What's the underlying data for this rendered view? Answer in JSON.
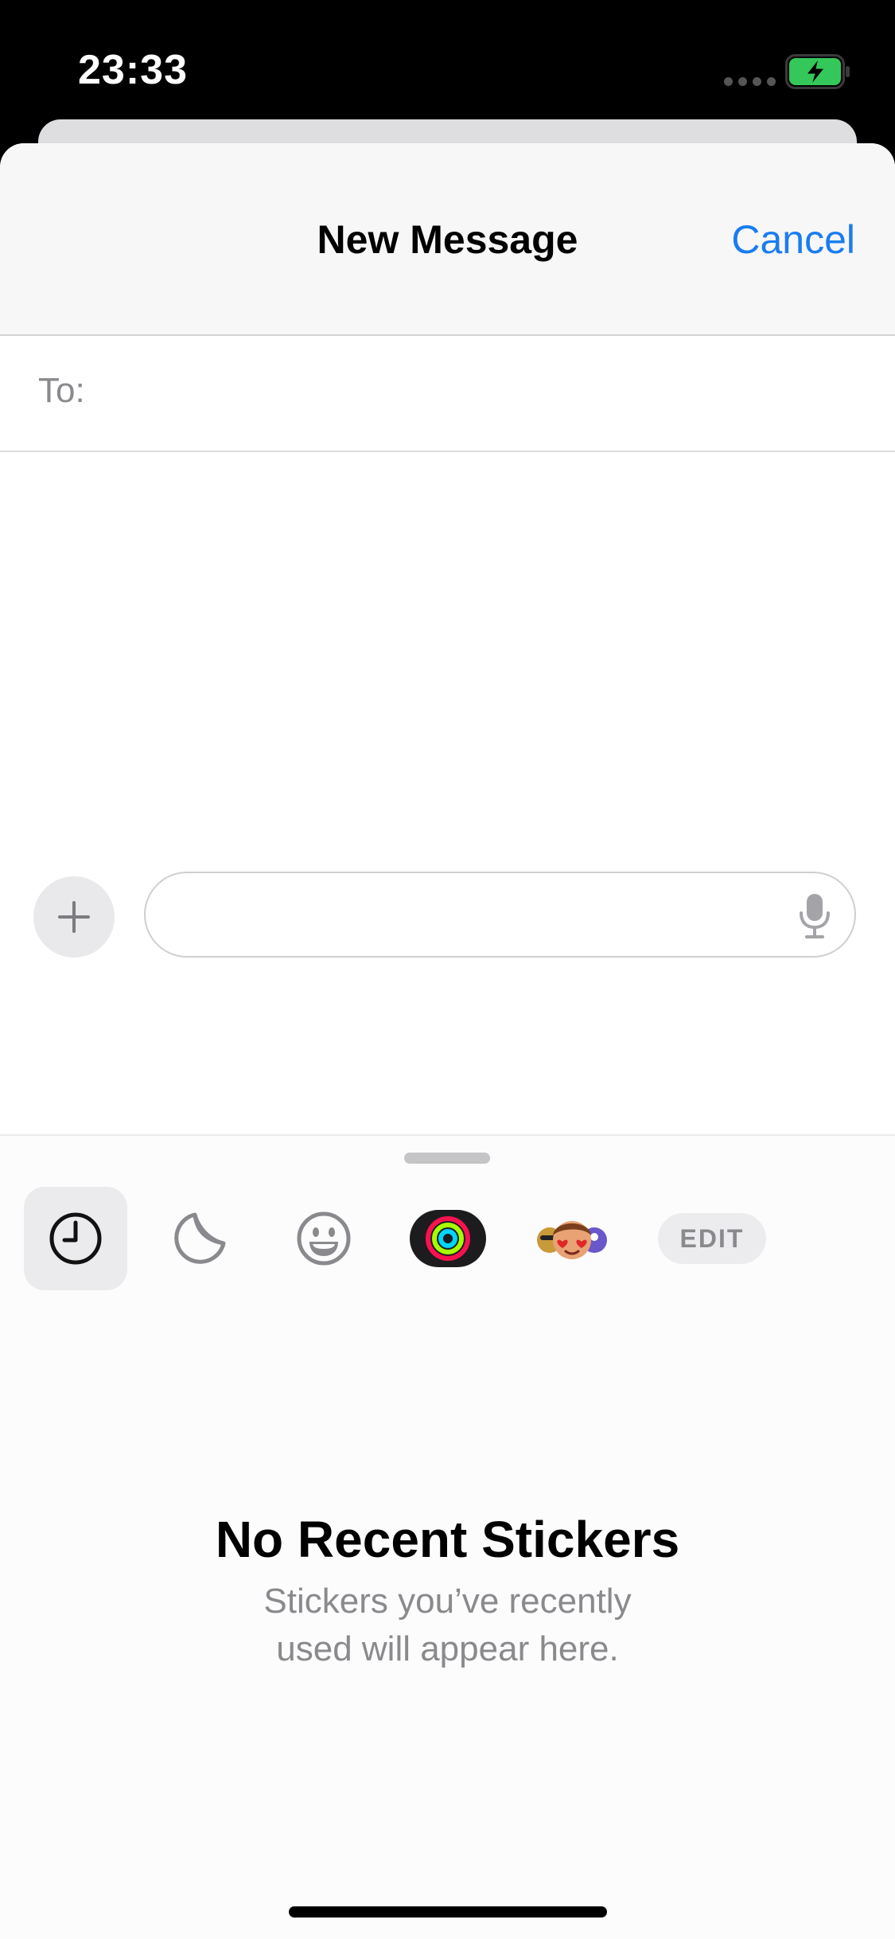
{
  "status_bar": {
    "time": "23:33",
    "battery_state": "charging",
    "battery_color": "#34c759"
  },
  "nav": {
    "title": "New Message",
    "cancel_label": "Cancel"
  },
  "recipient": {
    "label": "To:",
    "value": ""
  },
  "composer": {
    "value": "",
    "plus_icon": "plus-icon",
    "mic_icon": "microphone-icon"
  },
  "drawer": {
    "tabs": [
      {
        "name": "recent",
        "icon": "clock-icon",
        "selected": true
      },
      {
        "name": "stickers",
        "icon": "sticker-icon",
        "selected": false
      },
      {
        "name": "emoji",
        "icon": "smiley-icon",
        "selected": false
      },
      {
        "name": "activity",
        "icon": "activity-rings-icon",
        "selected": false
      },
      {
        "name": "memoji",
        "icon": "memoji-icon",
        "selected": false
      }
    ],
    "edit_label": "EDIT",
    "empty_title": "No Recent Stickers",
    "empty_line1": "Stickers you’ve recently",
    "empty_line2": "used will appear here."
  },
  "colors": {
    "accent": "#1a7cf0",
    "secondary_text": "#8a8a8e"
  }
}
